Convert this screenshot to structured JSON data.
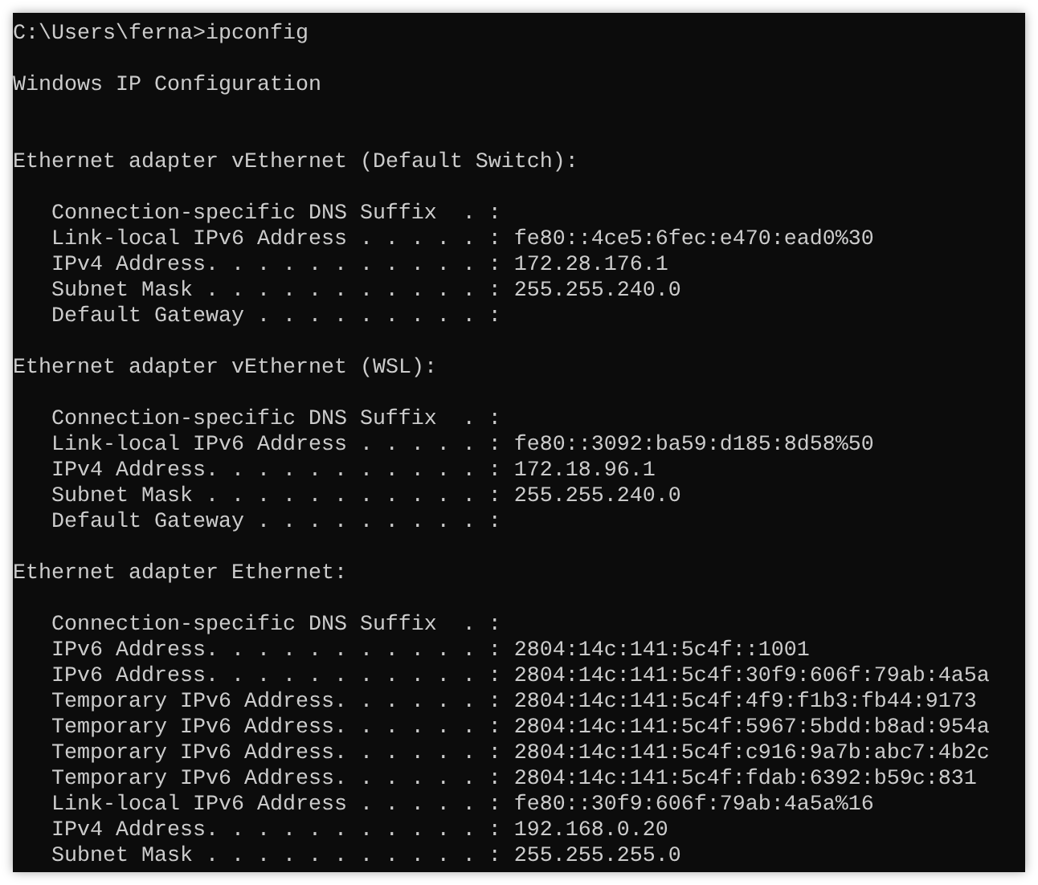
{
  "console": {
    "lines": [
      {
        "kind": "command",
        "text": "C:\\Users\\ferna>ipconfig"
      },
      {
        "kind": "blank"
      },
      {
        "kind": "heading",
        "text": "Windows IP Configuration"
      },
      {
        "kind": "blank"
      },
      {
        "kind": "blank"
      },
      {
        "kind": "heading",
        "text": "Ethernet adapter vEthernet (Default Switch):"
      },
      {
        "kind": "blank"
      },
      {
        "kind": "field",
        "label": "Connection-specific DNS Suffix  . :"
      },
      {
        "kind": "field",
        "label": "Link-local IPv6 Address . . . . . :",
        "value": "fe80::4ce5:6fec:e470:ead0%30"
      },
      {
        "kind": "field",
        "label": "IPv4 Address. . . . . . . . . . . :",
        "value": "172.28.176.1"
      },
      {
        "kind": "field",
        "label": "Subnet Mask . . . . . . . . . . . :",
        "value": "255.255.240.0"
      },
      {
        "kind": "field",
        "label": "Default Gateway . . . . . . . . . :"
      },
      {
        "kind": "blank"
      },
      {
        "kind": "heading",
        "text": "Ethernet adapter vEthernet (WSL):"
      },
      {
        "kind": "blank"
      },
      {
        "kind": "field",
        "label": "Connection-specific DNS Suffix  . :"
      },
      {
        "kind": "field",
        "label": "Link-local IPv6 Address . . . . . :",
        "value": "fe80::3092:ba59:d185:8d58%50"
      },
      {
        "kind": "field",
        "label": "IPv4 Address. . . . . . . . . . . :",
        "value": "172.18.96.1"
      },
      {
        "kind": "field",
        "label": "Subnet Mask . . . . . . . . . . . :",
        "value": "255.255.240.0"
      },
      {
        "kind": "field",
        "label": "Default Gateway . . . . . . . . . :"
      },
      {
        "kind": "blank"
      },
      {
        "kind": "heading",
        "text": "Ethernet adapter Ethernet:"
      },
      {
        "kind": "blank"
      },
      {
        "kind": "field",
        "label": "Connection-specific DNS Suffix  . :"
      },
      {
        "kind": "field",
        "label": "IPv6 Address. . . . . . . . . . . :",
        "value": "2804:14c:141:5c4f::1001"
      },
      {
        "kind": "field",
        "label": "IPv6 Address. . . . . . . . . . . :",
        "value": "2804:14c:141:5c4f:30f9:606f:79ab:4a5a"
      },
      {
        "kind": "field",
        "label": "Temporary IPv6 Address. . . . . . :",
        "value": "2804:14c:141:5c4f:4f9:f1b3:fb44:9173"
      },
      {
        "kind": "field",
        "label": "Temporary IPv6 Address. . . . . . :",
        "value": "2804:14c:141:5c4f:5967:5bdd:b8ad:954a"
      },
      {
        "kind": "field",
        "label": "Temporary IPv6 Address. . . . . . :",
        "value": "2804:14c:141:5c4f:c916:9a7b:abc7:4b2c"
      },
      {
        "kind": "field",
        "label": "Temporary IPv6 Address. . . . . . :",
        "value": "2804:14c:141:5c4f:fdab:6392:b59c:831"
      },
      {
        "kind": "field",
        "label": "Link-local IPv6 Address . . . . . :",
        "value": "fe80::30f9:606f:79ab:4a5a%16"
      },
      {
        "kind": "field",
        "label": "IPv4 Address. . . . . . . . . . . :",
        "value": "192.168.0.20"
      },
      {
        "kind": "field",
        "label": "Subnet Mask . . . . . . . . . . . :",
        "value": "255.255.255.0"
      }
    ]
  }
}
